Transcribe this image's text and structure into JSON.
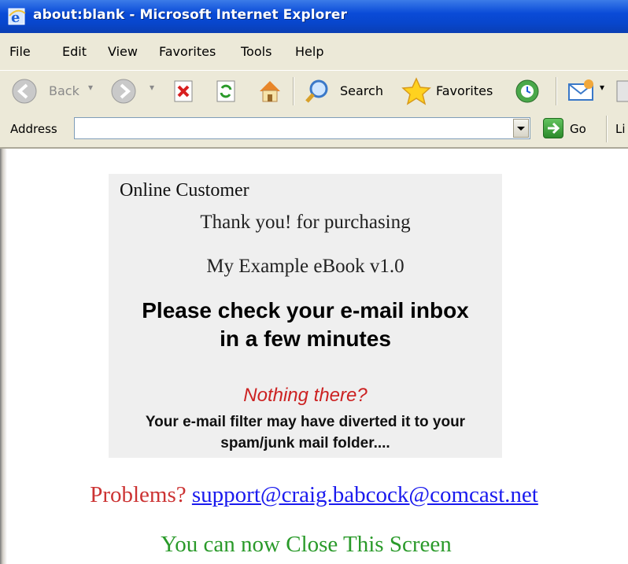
{
  "window": {
    "title": "about:blank - Microsoft Internet Explorer"
  },
  "menu": {
    "items": [
      "File",
      "Edit",
      "View",
      "Favorites",
      "Tools",
      "Help"
    ]
  },
  "toolbar": {
    "back_label": "Back",
    "search_label": "Search",
    "favorites_label": "Favorites"
  },
  "address": {
    "label": "Address",
    "value": "",
    "go_label": "Go",
    "links_label": "Li"
  },
  "page": {
    "heading": "Online Customer",
    "thanks": "Thank you! for purchasing",
    "product": "My Example eBook v1.0",
    "check_line1": "Please check your e-mail inbox",
    "check_line2": "in a few minutes",
    "nothing_there": "Nothing there?",
    "filter_line1": "Your e-mail filter may have diverted it to your",
    "filter_line2": "spam/junk mail folder....",
    "problems_label": "Problems?",
    "support_email": "support@craig.babcock@comcast.net",
    "close_message": "You can now Close This Screen"
  },
  "colors": {
    "titlebar": "#0a4bd8",
    "chrome": "#ece9d8",
    "panel": "#efefef",
    "nothing_there": "#cc2222",
    "problems": "#cc3333",
    "link": "#1a1aee",
    "close_message": "#2a9a2a"
  }
}
